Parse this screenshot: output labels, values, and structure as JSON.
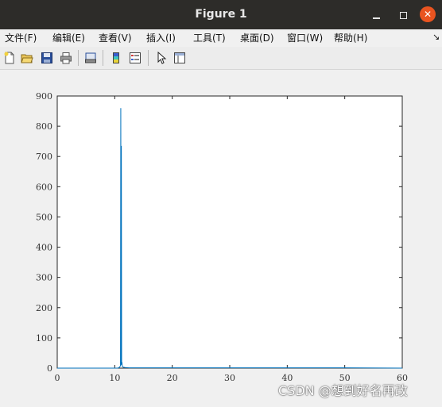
{
  "window": {
    "title": "Figure 1"
  },
  "menu": {
    "items": [
      "文件(F)",
      "编辑(E)",
      "查看(V)",
      "插入(I)",
      "工具(T)",
      "桌面(D)",
      "窗口(W)",
      "帮助(H)"
    ],
    "overflow": "↘"
  },
  "toolbar": {
    "icons": [
      "new-figure-icon",
      "open-file-icon",
      "save-icon",
      "print-icon",
      "print-preview-icon",
      "colorbar-icon",
      "legend-icon",
      "pointer-icon",
      "property-editor-icon"
    ]
  },
  "chart_data": {
    "type": "line",
    "title": "",
    "xlabel": "",
    "ylabel": "",
    "xlim": [
      0,
      60
    ],
    "ylim": [
      0,
      900
    ],
    "xticks": [
      0,
      10,
      20,
      30,
      40,
      50,
      60
    ],
    "yticks": [
      0,
      100,
      200,
      300,
      400,
      500,
      600,
      700,
      800,
      900
    ],
    "grid": false,
    "series": [
      {
        "color": "#0072bd",
        "x": [
          0,
          10.5,
          10.8,
          11.0,
          11.05,
          11.1,
          11.15,
          11.2,
          11.25,
          11.3,
          11.35,
          11.5,
          11.8,
          12.5,
          20,
          30,
          40,
          50,
          60
        ],
        "y": [
          0,
          0,
          2,
          8,
          860,
          10,
          735,
          12,
          20,
          8,
          5,
          3,
          2,
          1,
          1,
          1,
          1,
          1,
          0
        ]
      }
    ]
  },
  "watermark": "CSDN @想到好名再改",
  "colors": {
    "titlebar": "#2d2c29",
    "close": "#e95420",
    "line": "#0072bd"
  }
}
